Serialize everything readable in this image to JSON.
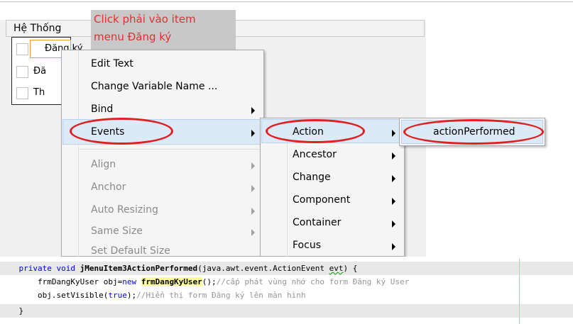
{
  "designer": {
    "menubar_title": "Hệ Thống",
    "dropdown_items": [
      "Đăng ký",
      "Đă",
      "Th"
    ]
  },
  "callout": {
    "line1": "Click phải vào item",
    "line2": "menu Đăng ký"
  },
  "context_menu": {
    "items": [
      {
        "label": "Edit Text",
        "enabled": true,
        "submenu": false
      },
      {
        "label": "Change Variable Name ...",
        "enabled": true,
        "submenu": false
      },
      {
        "label": "Bind",
        "enabled": true,
        "submenu": true
      },
      {
        "label": "Events",
        "enabled": true,
        "submenu": true,
        "highlighted": true
      },
      {
        "label": "Align",
        "enabled": false,
        "submenu": true
      },
      {
        "label": "Anchor",
        "enabled": false,
        "submenu": true
      },
      {
        "label": "Auto Resizing",
        "enabled": false,
        "submenu": true
      },
      {
        "label": "Same Size",
        "enabled": false,
        "submenu": true
      },
      {
        "label": "Set Default Size",
        "enabled": false,
        "submenu": false
      }
    ]
  },
  "events_submenu": {
    "items": [
      "Action",
      "Ancestor",
      "Change",
      "Component",
      "Container",
      "Focus"
    ],
    "highlighted": "Action"
  },
  "action_submenu": {
    "items": [
      "actionPerformed"
    ]
  },
  "code": {
    "line1_kw1": "private",
    "line1_kw2": "void",
    "line1_method": "jMenuItem3ActionPerformed",
    "line1_params": "(java.awt.event.ActionEvent ",
    "line1_evt": "evt",
    "line1_end": ") {",
    "line2_type": "frmDangKyUser obj=",
    "line2_new": "new",
    "line2_ctor": "frmDangKyUser",
    "line2_end": "();",
    "line2_comment": "//cấp phát vùng nhớ cho form Đăng ký User",
    "line3_call": "obj.setVisible(",
    "line3_true": "true",
    "line3_end": ");",
    "line3_comment": "//Hiển thị form Đăng ký lên màn hình",
    "line4": "}"
  },
  "colors": {
    "annotation": "#e02020",
    "keyword": "#0000e6",
    "comment": "#969696",
    "menu_highlight": "#dce9f7"
  }
}
